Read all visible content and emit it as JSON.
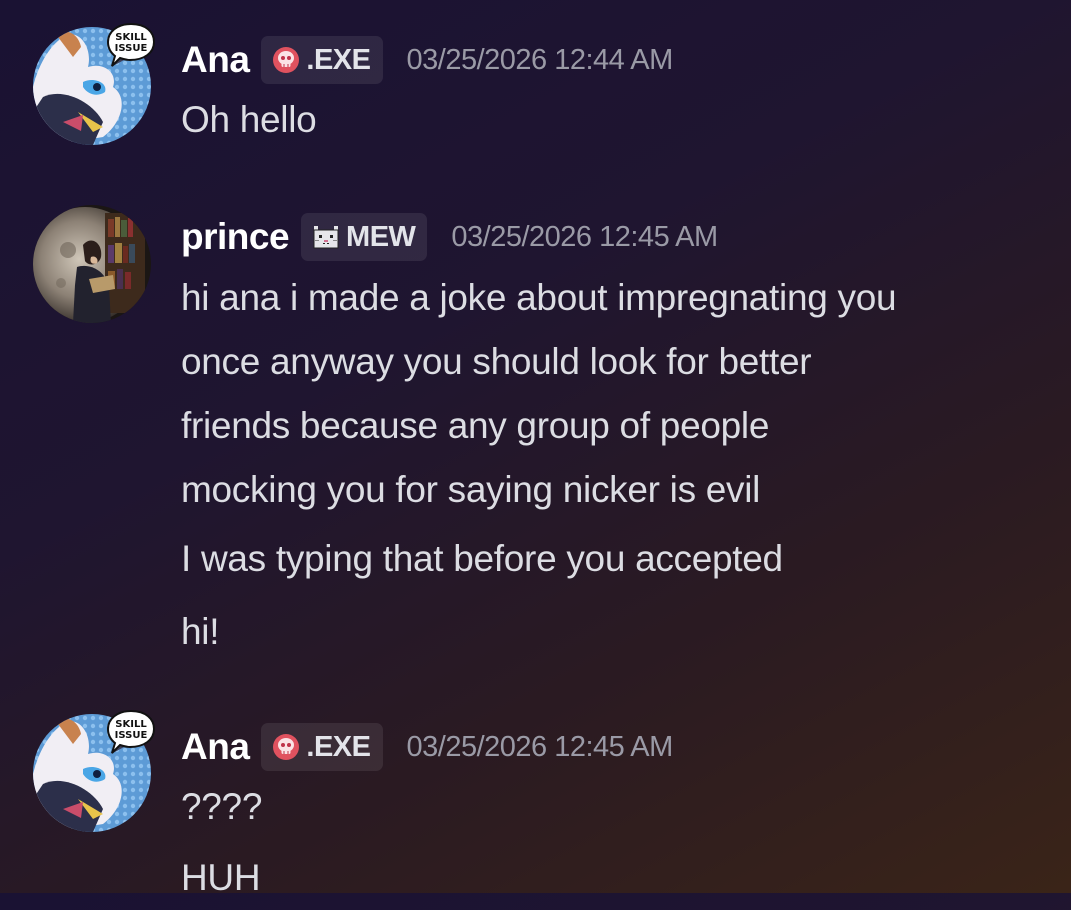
{
  "messages": [
    {
      "username": "Ana",
      "tag": ".EXE",
      "tag_icon": "skull-icon",
      "timestamp": "03/25/2026 12:44 AM",
      "avatar_badge": "SKILL ISSUE",
      "lines": [
        "Oh hello"
      ]
    },
    {
      "username": "prince",
      "tag": "MEW",
      "tag_icon": "cat-icon",
      "timestamp": "03/25/2026 12:45 AM",
      "lines": [
        "hi ana i made a joke about impregnating you",
        "once anyway you should look for better",
        "friends because any group of people",
        "mocking you for saying nicker is evil",
        "I was typing that before you accepted",
        "hi!"
      ]
    },
    {
      "username": "Ana",
      "tag": ".EXE",
      "tag_icon": "skull-icon",
      "timestamp": "03/25/2026 12:45 AM",
      "avatar_badge": "SKILL ISSUE",
      "lines": [
        "????",
        "HUH"
      ]
    }
  ],
  "colors": {
    "username": "#ffffff",
    "message_text": "#dcdde3",
    "timestamp": "#9a9aa6",
    "skull_tag": "#e0525f"
  }
}
